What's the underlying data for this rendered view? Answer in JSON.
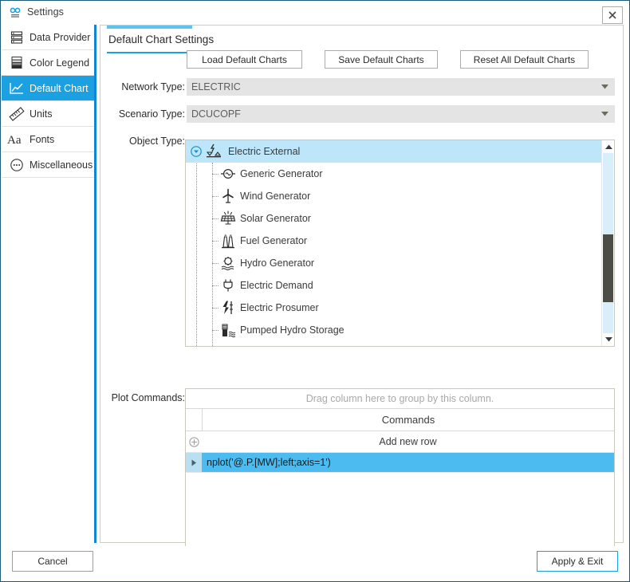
{
  "window": {
    "title": "Settings",
    "app_icon": "settings-link-icon",
    "close_label": "✖"
  },
  "sidebar": {
    "items": [
      {
        "label": "Data Provider",
        "icon": "database-icon",
        "selected": false
      },
      {
        "label": "Color Legend",
        "icon": "color-legend-icon",
        "selected": false
      },
      {
        "label": "Default Chart",
        "icon": "line-chart-icon",
        "selected": true
      },
      {
        "label": "Units",
        "icon": "ruler-icon",
        "selected": false
      },
      {
        "label": "Fonts",
        "icon": "font-aa-icon",
        "selected": false
      },
      {
        "label": "Miscellaneous",
        "icon": "ellipsis-circle-icon",
        "selected": false
      }
    ]
  },
  "content": {
    "tab_label": "Default Chart Settings",
    "toolbar": {
      "load_label": "Load Default Charts",
      "save_label": "Save Default Charts",
      "reset_label": "Reset All Default Charts"
    },
    "fields": {
      "network_type_label": "Network Type:",
      "network_type_value": "ELECTRIC",
      "scenario_type_label": "Scenario Type:",
      "scenario_type_value": "DCUCOPF",
      "object_type_label": "Object Type:"
    },
    "tree": {
      "root": {
        "label": "Electric External",
        "icon": "electric-external-icon",
        "expanded": true,
        "selected": true
      },
      "children": [
        {
          "label": "Generic Generator",
          "icon": "generic-generator-icon"
        },
        {
          "label": "Wind Generator",
          "icon": "wind-generator-icon"
        },
        {
          "label": "Solar Generator",
          "icon": "solar-generator-icon"
        },
        {
          "label": "Fuel Generator",
          "icon": "fuel-generator-icon"
        },
        {
          "label": "Hydro Generator",
          "icon": "hydro-generator-icon"
        },
        {
          "label": "Electric Demand",
          "icon": "electric-demand-icon"
        },
        {
          "label": "Electric Prosumer",
          "icon": "electric-prosumer-icon"
        },
        {
          "label": "Pumped Hydro Storage",
          "icon": "pumped-hydro-storage-icon"
        }
      ]
    },
    "plot_commands": {
      "label": "Plot Commands:",
      "group_hint": "Drag column here to group by this column.",
      "columns": [
        "Commands"
      ],
      "add_row_label": "Add new row",
      "rows": [
        {
          "command": "nplot('@.P.[MW];left;axis=1')",
          "selected": true
        }
      ]
    }
  },
  "footer": {
    "cancel_label": "Cancel",
    "apply_label": "Apply & Exit"
  },
  "colors": {
    "accent": "#1ba1e2",
    "selection": "#4cbcf0",
    "tree_selection": "#bde6fb",
    "rail": "#1186d8",
    "window_border": "#1e5b7a"
  }
}
